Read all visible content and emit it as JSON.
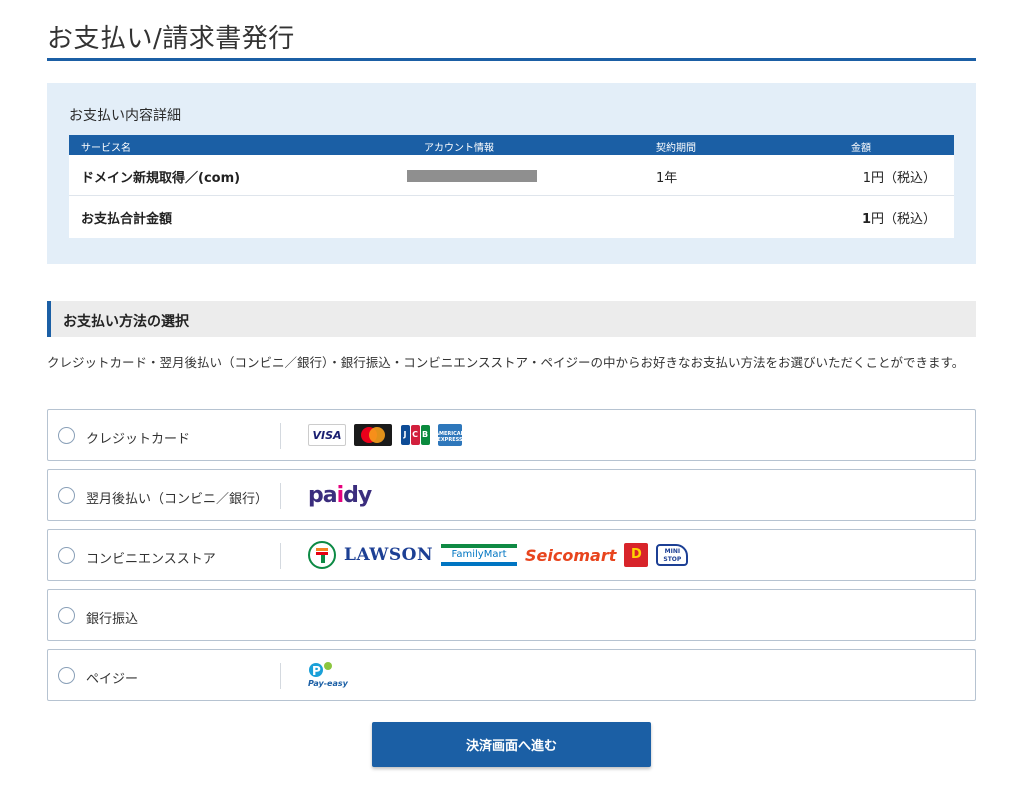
{
  "page": {
    "title": "お支払い/請求書発行"
  },
  "details": {
    "heading": "お支払い内容詳細",
    "columns": [
      "サービス名",
      "アカウント情報",
      "契約期間",
      "金額"
    ],
    "rows": [
      {
        "service": "ドメイン新規取得／(com)",
        "account": "",
        "period": "1年",
        "amount": "1円（税込）"
      }
    ],
    "total": {
      "label": "お支払合計金額",
      "amount_number": "1",
      "amount_suffix": "円（税込）"
    }
  },
  "payment": {
    "section_title": "お支払い方法の選択",
    "description": "クレジットカード・翌月後払い（コンビニ／銀行）・銀行振込・コンビニエンスストア・ペイジーの中からお好きなお支払い方法をお選びいただくことができます。",
    "methods": [
      {
        "label": "クレジットカード",
        "logos": [
          "visa-logo",
          "mastercard-logo",
          "jcb-logo",
          "amex-logo"
        ]
      },
      {
        "label": "翌月後払い（コンビニ／銀行）",
        "logos": [
          "paidy-logo"
        ]
      },
      {
        "label": "コンビニエンスストア",
        "logos": [
          "seven-eleven-logo",
          "lawson-logo",
          "familymart-logo",
          "seicomart-logo",
          "daily-yamazaki-logo",
          "ministop-logo"
        ]
      },
      {
        "label": "銀行振込",
        "logos": []
      },
      {
        "label": "ペイジー",
        "logos": [
          "pay-easy-logo"
        ]
      }
    ]
  },
  "logo_text": {
    "visa": "VISA",
    "jcb": [
      "J",
      "C",
      "B"
    ],
    "amex": "AMERICAN EXPRESS",
    "paidy_a": "pa",
    "paidy_b": "i",
    "paidy_c": "dy",
    "lawson": "LAWSON",
    "familymart": "FamilyMart",
    "seicomart": "Seicomart",
    "daily": "D",
    "ministop": "MINI STOP",
    "payeasy": "Pay-easy"
  },
  "submit": {
    "label": "決済画面へ進む"
  },
  "colors": {
    "accent": "#1b5fa5",
    "panel_bg": "#e3eef8",
    "section_bg": "#ececec",
    "border": "#b6c3d1"
  }
}
